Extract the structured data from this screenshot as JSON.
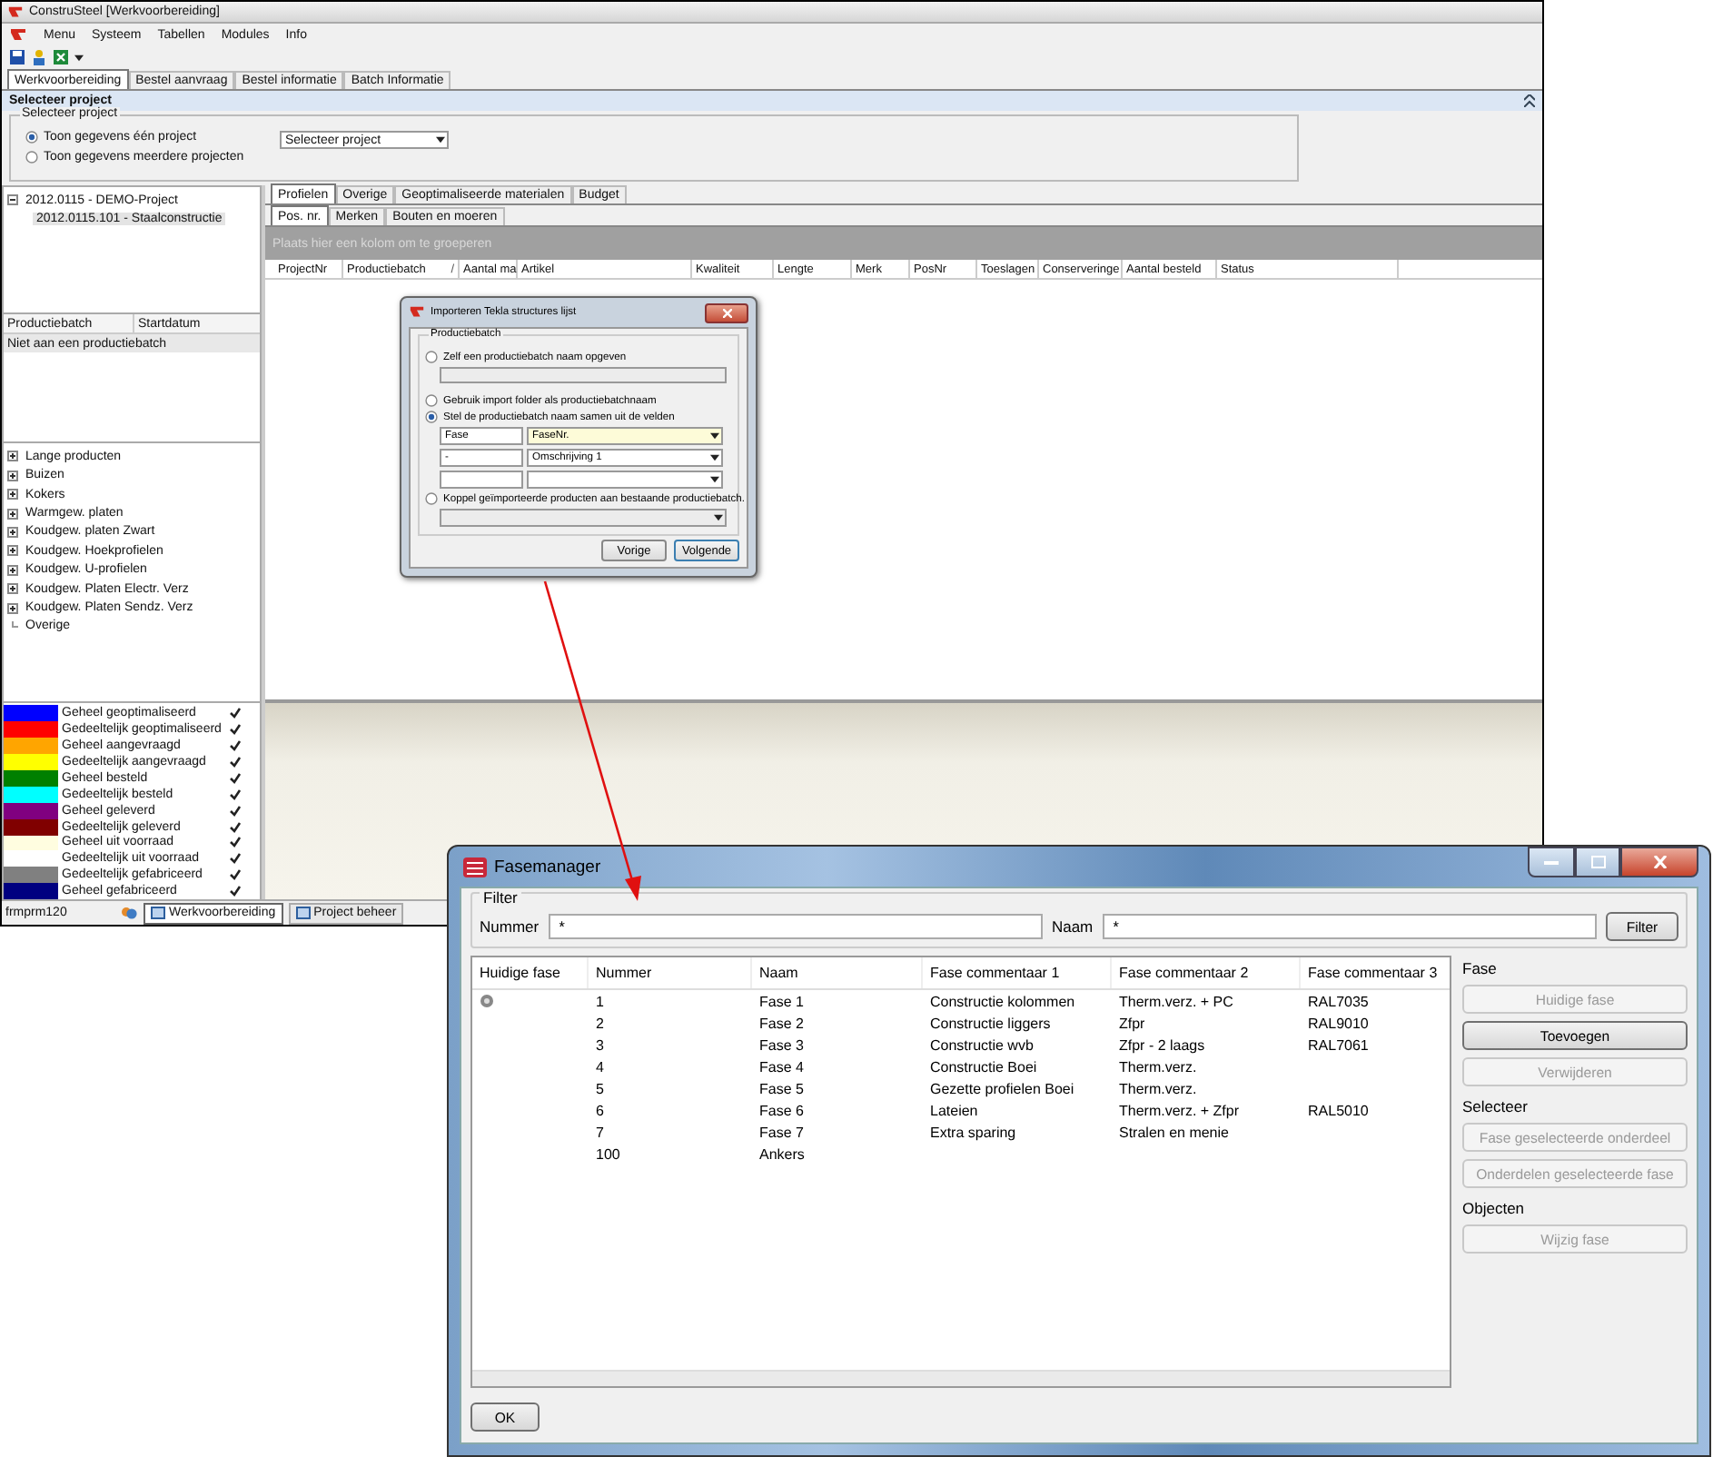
{
  "main_window": {
    "title": "ConstruSteel [Werkvoorbereiding]",
    "menu": [
      "Menu",
      "Systeem",
      "Tabellen",
      "Modules",
      "Info"
    ],
    "tabs": [
      {
        "label": "Werkvoorbereiding",
        "selected": true
      },
      {
        "label": "Bestel aanvraag",
        "selected": false
      },
      {
        "label": "Bestel informatie",
        "selected": false
      },
      {
        "label": "Batch Informatie",
        "selected": false
      }
    ],
    "section_title": "Selecteer project",
    "project_group": {
      "legend": "Selecteer project",
      "options": [
        {
          "label": "Toon gegevens één project",
          "selected": true
        },
        {
          "label": "Toon gegevens meerdere projecten",
          "selected": false
        }
      ],
      "select": "Selecteer project"
    },
    "project_tree": [
      {
        "label": "2012.0115 - DEMO-Project",
        "expanded": true,
        "selected": false,
        "children": [
          {
            "label": "2012.0115.101 - Staalconstructie",
            "selected": true
          }
        ]
      }
    ],
    "batch_table": {
      "columns": [
        "Productiebatch",
        "Startdatum"
      ],
      "rows": [
        {
          "cells": [
            "Niet aan een productiebatch"
          ],
          "selected": true
        }
      ]
    },
    "product_tree": [
      {
        "label": "Lange producten",
        "expandable": true
      },
      {
        "label": "Buizen",
        "expandable": true
      },
      {
        "label": "Kokers",
        "expandable": true
      },
      {
        "label": "Warmgew. platen",
        "expandable": true
      },
      {
        "label": "Koudgew. platen Zwart",
        "expandable": true
      },
      {
        "label": "Koudgew. Hoekprofielen",
        "expandable": true
      },
      {
        "label": "Koudgew. U-profielen",
        "expandable": true
      },
      {
        "label": "Koudgew. Platen Electr. Verz",
        "expandable": true
      },
      {
        "label": "Koudgew. Platen Sendz. Verz",
        "expandable": true
      },
      {
        "label": "Overige",
        "expandable": false
      }
    ],
    "legend": [
      {
        "label": "Geheel geoptimaliseerd",
        "color": "#0000ff",
        "checked": true
      },
      {
        "label": "Gedeeltelijk geoptimaliseerd",
        "color": "#ff0000",
        "checked": true
      },
      {
        "label": "Geheel aangevraagd",
        "color": "#ffa500",
        "checked": true
      },
      {
        "label": "Gedeeltelijk aangevraagd",
        "color": "#ffff00",
        "checked": true
      },
      {
        "label": "Geheel besteld",
        "color": "#008000",
        "checked": true
      },
      {
        "label": "Gedeeltelijk besteld",
        "color": "#00ffff",
        "checked": true
      },
      {
        "label": "Geheel geleverd",
        "color": "#800080",
        "checked": true
      },
      {
        "label": "Gedeeltelijk geleverd",
        "color": "#800000",
        "checked": true
      },
      {
        "label": "Geheel uit voorraad",
        "color": "#fffde0",
        "checked": true
      },
      {
        "label": "Gedeeltelijk uit voorraad",
        "color": "#ffffff",
        "checked": true
      },
      {
        "label": "Gedeeltelijk gefabriceerd",
        "color": "#808080",
        "checked": true
      },
      {
        "label": "Geheel gefabriceerd",
        "color": "#000080",
        "checked": true
      }
    ],
    "content_tabs": [
      {
        "label": "Profielen",
        "selected": true
      },
      {
        "label": "Overige",
        "selected": false
      },
      {
        "label": "Geoptimaliseerde materialen",
        "selected": false
      },
      {
        "label": "Budget",
        "selected": false
      }
    ],
    "sub_tabs": [
      {
        "label": "Pos. nr.",
        "selected": true
      },
      {
        "label": "Merken",
        "selected": false
      },
      {
        "label": "Bouten en moeren",
        "selected": false
      }
    ],
    "group_hint": "Plaats hier een kolom om te groeperen",
    "grid_columns": [
      {
        "label": "ProjectNr"
      },
      {
        "label": "Productiebatch",
        "sort_glyph": "/"
      },
      {
        "label": "Aantal ma"
      },
      {
        "label": "Artikel"
      },
      {
        "label": "Kwaliteit"
      },
      {
        "label": "Lengte"
      },
      {
        "label": "Merk"
      },
      {
        "label": "PosNr"
      },
      {
        "label": "Toeslagen"
      },
      {
        "label": "Conserveringe"
      },
      {
        "label": "Aantal besteld"
      },
      {
        "label": "Status"
      }
    ],
    "status_bar": {
      "user": "frmprm120",
      "tasks": [
        {
          "label": "Werkvoorbereiding",
          "selected": true
        },
        {
          "label": "Project beheer",
          "selected": false
        }
      ]
    }
  },
  "import_dialog": {
    "title": "Importeren Tekla structures lijst",
    "group": "Productiebatch",
    "options": [
      {
        "kind": "field",
        "label": "Zelf een productiebatch naam opgeven",
        "selected": false
      },
      {
        "kind": "plain",
        "label": "Gebruik import folder als productiebatchnaam",
        "selected": false
      },
      {
        "kind": "parts",
        "label": "Stel de productiebatch naam samen uit de velden",
        "selected": true
      },
      {
        "kind": "combo",
        "label": "Koppel geïmporteerde producten aan bestaande productiebatch.",
        "selected": false
      }
    ],
    "name_parts": [
      {
        "text": "Fase",
        "field": "FaseNr.",
        "highlighted": true
      },
      {
        "text": "-",
        "field": "Omschrijving 1",
        "highlighted": false
      },
      {
        "highlighted": false
      }
    ],
    "buttons": [
      {
        "label": "Vorige",
        "default": false
      },
      {
        "label": "Volgende",
        "default": true
      }
    ]
  },
  "fasemanager": {
    "title": "Fasemanager",
    "filter": {
      "legend": "Filter",
      "fields": [
        {
          "label": "Nummer",
          "value": "*"
        },
        {
          "label": "Naam",
          "value": "*"
        }
      ],
      "button": "Filter"
    },
    "columns": [
      "Huidige fase",
      "Nummer",
      "Naam",
      "Fase commentaar 1",
      "Fase commentaar 2",
      "Fase commentaar 3"
    ],
    "rows": [
      {
        "current": true,
        "cells": [
          "",
          "1",
          "Fase 1",
          "Constructie kolommen",
          "Therm.verz. + PC",
          "RAL7035"
        ]
      },
      {
        "current": false,
        "cells": [
          "",
          "2",
          "Fase 2",
          "Constructie liggers",
          "Zfpr",
          "RAL9010"
        ]
      },
      {
        "current": false,
        "cells": [
          "",
          "3",
          "Fase 3",
          "Constructie wvb",
          "Zfpr - 2 laags",
          "RAL7061"
        ]
      },
      {
        "current": false,
        "cells": [
          "",
          "4",
          "Fase 4",
          "Constructie Boei",
          "Therm.verz."
        ]
      },
      {
        "current": false,
        "cells": [
          "",
          "5",
          "Fase 5",
          "Gezette profielen Boei",
          "Therm.verz."
        ]
      },
      {
        "current": false,
        "cells": [
          "",
          "6",
          "Fase 6",
          "Lateien",
          "Therm.verz. + Zfpr",
          "RAL5010"
        ]
      },
      {
        "current": false,
        "cells": [
          "",
          "7",
          "Fase 7",
          "Extra sparing",
          "Stralen en menie"
        ]
      },
      {
        "current": false,
        "cells": [
          "",
          "100",
          "Ankers"
        ]
      }
    ],
    "groups": [
      {
        "title": "Fase",
        "buttons": [
          {
            "label": "Huidige fase",
            "disabled": true
          },
          {
            "label": "Toevoegen",
            "disabled": false
          },
          {
            "label": "Verwijderen",
            "disabled": true
          }
        ]
      },
      {
        "title": "Selecteer",
        "buttons": [
          {
            "label": "Fase geselecteerde onderdeel",
            "disabled": true
          },
          {
            "label": "Onderdelen geselecteerde fase",
            "disabled": true
          }
        ]
      },
      {
        "title": "Objecten",
        "buttons": [
          {
            "label": "Wijzig fase",
            "disabled": true
          }
        ]
      }
    ],
    "ok": "OK"
  }
}
